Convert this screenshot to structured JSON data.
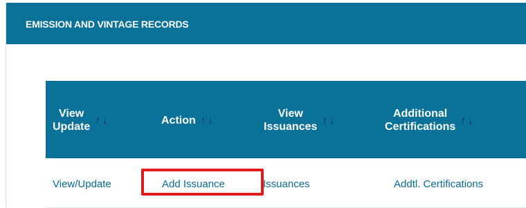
{
  "panel": {
    "title": "EMISSION AND VINTAGE RECORDS"
  },
  "table": {
    "columns": [
      {
        "label_line1": "View",
        "label_line2": "Update"
      },
      {
        "label_line1": "Action",
        "label_line2": ""
      },
      {
        "label_line1": "View",
        "label_line2": "Issuances"
      },
      {
        "label_line1": "Additional",
        "label_line2": "Certifications"
      }
    ],
    "sort_up": "↑",
    "sort_down": "↓",
    "rows": [
      {
        "view_update": "View/Update",
        "action": "Add Issuance",
        "issuances": "Issuances",
        "certifications": "Addtl. Certifications"
      }
    ]
  },
  "colors": {
    "header_bg": "#0a7199",
    "link": "#0a6a96",
    "highlight_border": "#e01b1b"
  }
}
